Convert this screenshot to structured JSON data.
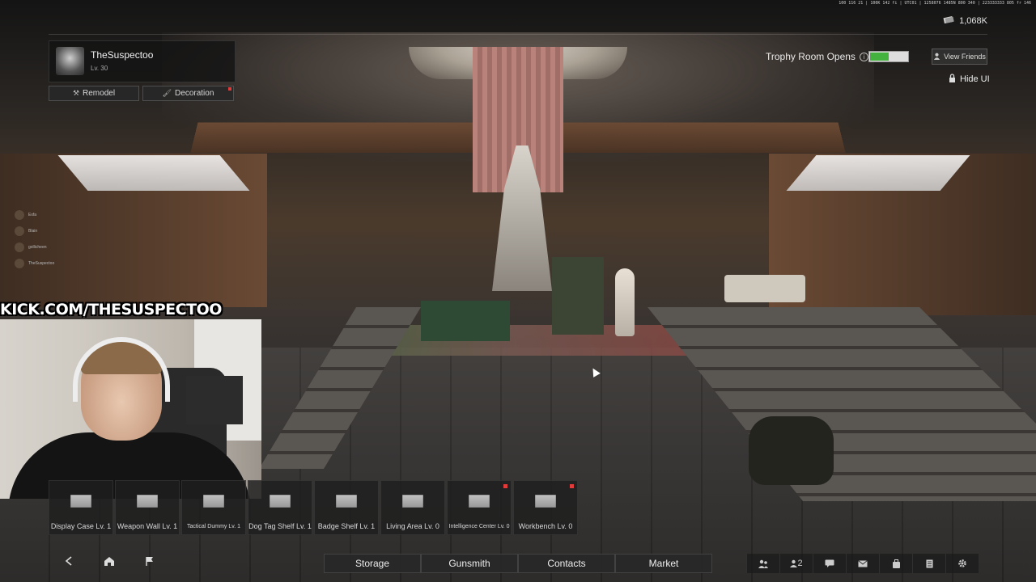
{
  "system_info": "100 116 21 | 100K 142 fi | UTC01 | 1258076 1485N 800 340 | 223333333 805 fr 146",
  "currency": {
    "icon": "money-icon",
    "amount": "1,068K"
  },
  "profile": {
    "name": "TheSuspectoo",
    "level": "Lv. 30",
    "remodel_label": "Remodel",
    "decoration_label": "Decoration"
  },
  "trophy": {
    "label": "Trophy Room Opens",
    "progress": 0.5,
    "fill_color": "#43b23e"
  },
  "view_friends_label": "View Friends",
  "hide_ui_label": "Hide UI",
  "stream_overlay": [
    "Exfa",
    "Blain",
    "gollicheen",
    "TheSuspectoo"
  ],
  "kick_banner": "KICK.COM/THESUSPECTOO",
  "buildings": [
    {
      "label": "Display Case Lv. 1",
      "alert": false,
      "small": false
    },
    {
      "label": "Weapon Wall Lv. 1",
      "alert": false,
      "small": false
    },
    {
      "label": "Tactical Dummy Lv. 1",
      "alert": false,
      "small": true
    },
    {
      "label": "Dog Tag Shelf Lv. 1",
      "alert": false,
      "small": false
    },
    {
      "label": "Badge Shelf Lv. 1",
      "alert": false,
      "small": false
    },
    {
      "label": "Living Area Lv. 0",
      "alert": false,
      "small": false
    },
    {
      "label": "Intelligence Center Lv. 0",
      "alert": true,
      "small": true
    },
    {
      "label": "Workbench Lv. 0",
      "alert": true,
      "small": false
    }
  ],
  "main_menu": [
    "Storage",
    "Gunsmith",
    "Contacts",
    "Market"
  ],
  "right_nav": [
    {
      "icon": "squad-icon",
      "text": ""
    },
    {
      "icon": "friends-icon",
      "text": "2"
    },
    {
      "icon": "chat-icon",
      "text": ""
    },
    {
      "icon": "mail-icon",
      "text": ""
    },
    {
      "icon": "bag-icon",
      "text": ""
    },
    {
      "icon": "notes-icon",
      "text": ""
    },
    {
      "icon": "settings-icon",
      "text": ""
    }
  ],
  "accent_red": "#e23b3b"
}
